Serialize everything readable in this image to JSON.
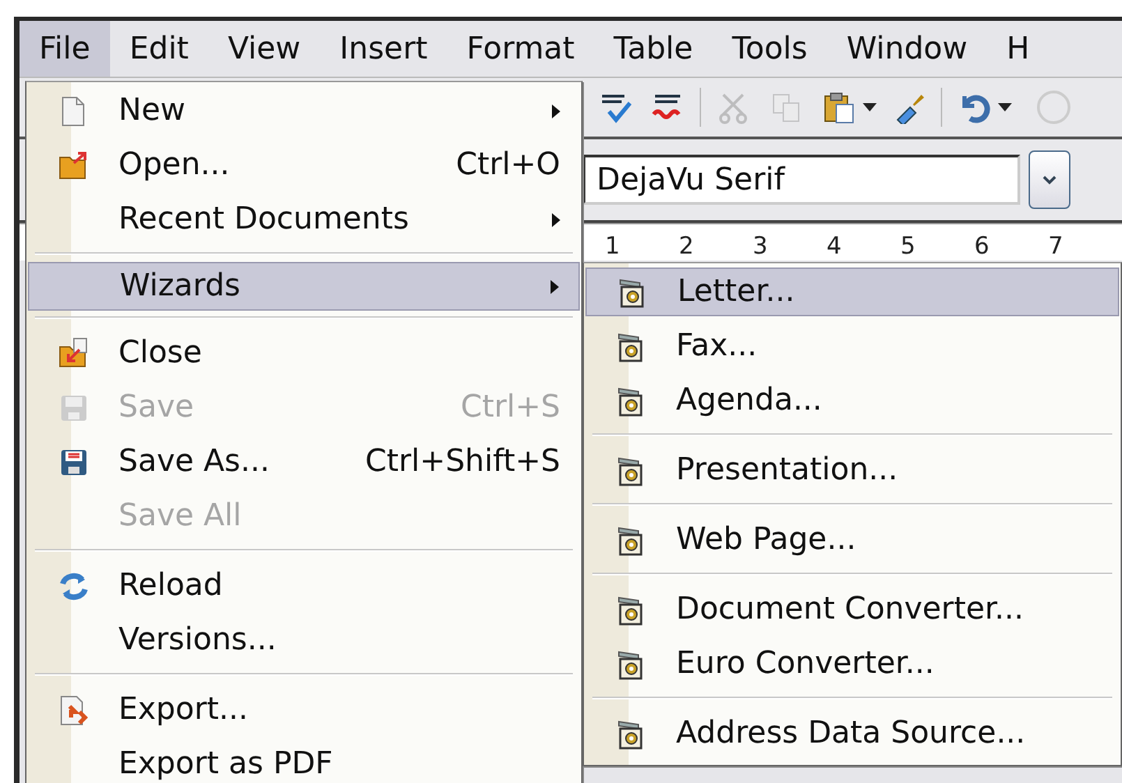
{
  "menubar": [
    {
      "label": "File",
      "selected": true
    },
    {
      "label": "Edit",
      "selected": false
    },
    {
      "label": "View",
      "selected": false
    },
    {
      "label": "Insert",
      "selected": false
    },
    {
      "label": "Format",
      "selected": false
    },
    {
      "label": "Table",
      "selected": false
    },
    {
      "label": "Tools",
      "selected": false
    },
    {
      "label": "Window",
      "selected": false
    },
    {
      "label": "H",
      "selected": false
    }
  ],
  "toolbar": {
    "buttons": [
      {
        "disabled": false
      },
      {
        "disabled": false
      },
      {
        "disabled": true
      },
      {
        "disabled": true
      },
      {
        "disabled": false
      },
      {
        "disabled": false
      },
      {
        "disabled": false
      }
    ]
  },
  "font_name": {
    "value": "DejaVu Serif"
  },
  "ruler": {
    "labels": [
      "1",
      "2",
      "3",
      "4",
      "5",
      "6",
      "7"
    ]
  },
  "file_menu": {
    "items": [
      {
        "kind": "item",
        "label": "New",
        "submenu": true,
        "disabled": false,
        "selected": false
      },
      {
        "kind": "item",
        "label": "Open...",
        "shortcut": "Ctrl+O",
        "disabled": false,
        "selected": false
      },
      {
        "kind": "item",
        "label": "Recent Documents",
        "submenu": true,
        "disabled": false,
        "selected": false
      },
      {
        "kind": "separator"
      },
      {
        "kind": "item",
        "label": "Wizards",
        "submenu": true,
        "disabled": false,
        "selected": true
      },
      {
        "kind": "separator"
      },
      {
        "kind": "item",
        "label": "Close",
        "disabled": false,
        "selected": false
      },
      {
        "kind": "item",
        "label": "Save",
        "shortcut": "Ctrl+S",
        "disabled": true,
        "selected": false
      },
      {
        "kind": "item",
        "label": "Save As...",
        "shortcut": "Ctrl+Shift+S",
        "disabled": false,
        "selected": false
      },
      {
        "kind": "item",
        "label": "Save All",
        "disabled": true,
        "selected": false
      },
      {
        "kind": "separator"
      },
      {
        "kind": "item",
        "label": "Reload",
        "disabled": false,
        "selected": false
      },
      {
        "kind": "item",
        "label": "Versions...",
        "disabled": false,
        "selected": false
      },
      {
        "kind": "separator"
      },
      {
        "kind": "item",
        "label": "Export...",
        "disabled": false,
        "selected": false
      },
      {
        "kind": "item",
        "label": "Export as PDF",
        "disabled": false,
        "selected": false
      }
    ]
  },
  "wizards_menu": {
    "items": [
      {
        "kind": "item",
        "label": "Letter...",
        "disabled": false,
        "selected": true
      },
      {
        "kind": "item",
        "label": "Fax...",
        "disabled": false,
        "selected": false
      },
      {
        "kind": "item",
        "label": "Agenda...",
        "disabled": false,
        "selected": false
      },
      {
        "kind": "separator"
      },
      {
        "kind": "item",
        "label": "Presentation...",
        "disabled": false,
        "selected": false
      },
      {
        "kind": "separator"
      },
      {
        "kind": "item",
        "label": "Web Page...",
        "disabled": false,
        "selected": false
      },
      {
        "kind": "separator"
      },
      {
        "kind": "item",
        "label": "Document Converter...",
        "disabled": false,
        "selected": false
      },
      {
        "kind": "item",
        "label": "Euro Converter...",
        "disabled": false,
        "selected": false
      },
      {
        "kind": "separator"
      },
      {
        "kind": "item",
        "label": "Address Data Source...",
        "disabled": false,
        "selected": false
      }
    ]
  }
}
